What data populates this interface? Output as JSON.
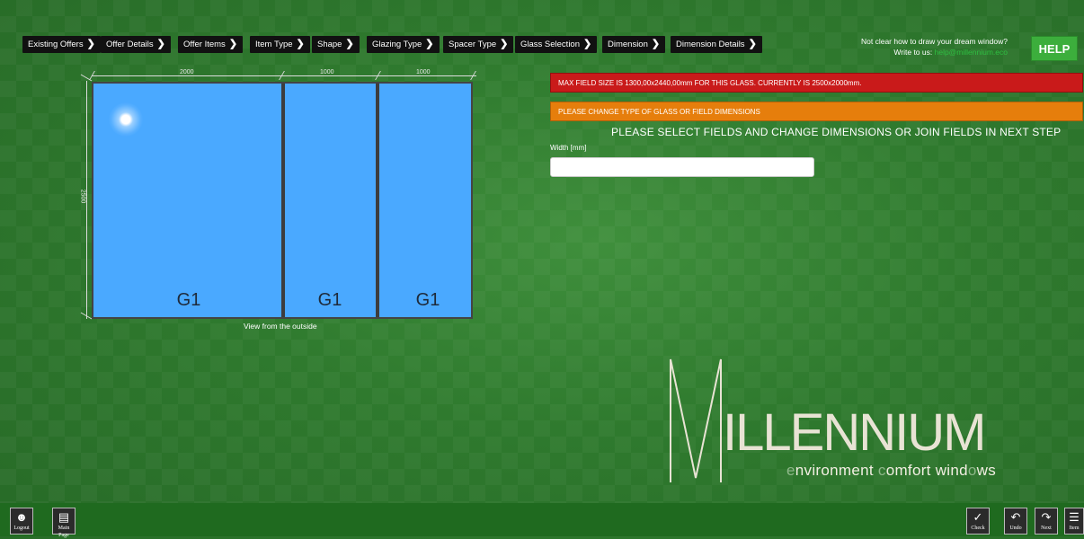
{
  "nav": {
    "items": [
      {
        "label": "Existing Offers"
      },
      {
        "label": "Offer Details"
      },
      {
        "label": "Offer Items"
      },
      {
        "label": "Item Type"
      },
      {
        "label": "Shape"
      },
      {
        "label": "Glazing Type"
      },
      {
        "label": "Spacer Type"
      },
      {
        "label": "Glass Selection"
      },
      {
        "label": "Dimension"
      },
      {
        "label": "Dimension Details"
      }
    ],
    "chevron": "❯"
  },
  "help": {
    "line1": "Not clear how to draw your dream window?",
    "line2_prefix": "Write to us: ",
    "email": "help@millennium.eco",
    "button": "HELP"
  },
  "drawing": {
    "dims_top": [
      "2000",
      "1000",
      "1000"
    ],
    "dim_left": "2500",
    "panes": [
      "G1",
      "G1",
      "G1"
    ],
    "caption": "View from the outside"
  },
  "alerts": {
    "error": "MAX FIELD SIZE IS 1300,00x2440,00mm FOR THIS GLASS. CURRENTLY IS 2500x2000mm.",
    "warning": "PLEASE CHANGE TYPE OF GLASS OR FIELD DIMENSIONS"
  },
  "instruction": "PLEASE SELECT FIELDS AND CHANGE DIMENSIONS OR JOIN FIELDS IN NEXT STEP",
  "width_field": {
    "label": "Width [mm]",
    "value": ""
  },
  "logo": {
    "word": "ILLENNIUM",
    "tag_parts": [
      "e",
      "nvironment ",
      "c",
      "omfort wind",
      "o",
      "ws"
    ]
  },
  "bottom": {
    "left": [
      {
        "caption": "Logout",
        "icon": "user-icon"
      },
      {
        "caption": "Main Page",
        "icon": "page-icon"
      }
    ],
    "right": [
      {
        "caption": "Check",
        "icon": "check-icon"
      },
      {
        "caption": "Undo",
        "icon": "undo-icon"
      },
      {
        "caption": "Next",
        "icon": "redo-icon"
      },
      {
        "caption": "Item",
        "icon": "item-icon"
      }
    ]
  },
  "colors": {
    "bg": "#2f7a2e",
    "error": "#c91a1a",
    "warning": "#e67e0c",
    "glass": "#4aa9ff",
    "help": "#3cae3c"
  }
}
